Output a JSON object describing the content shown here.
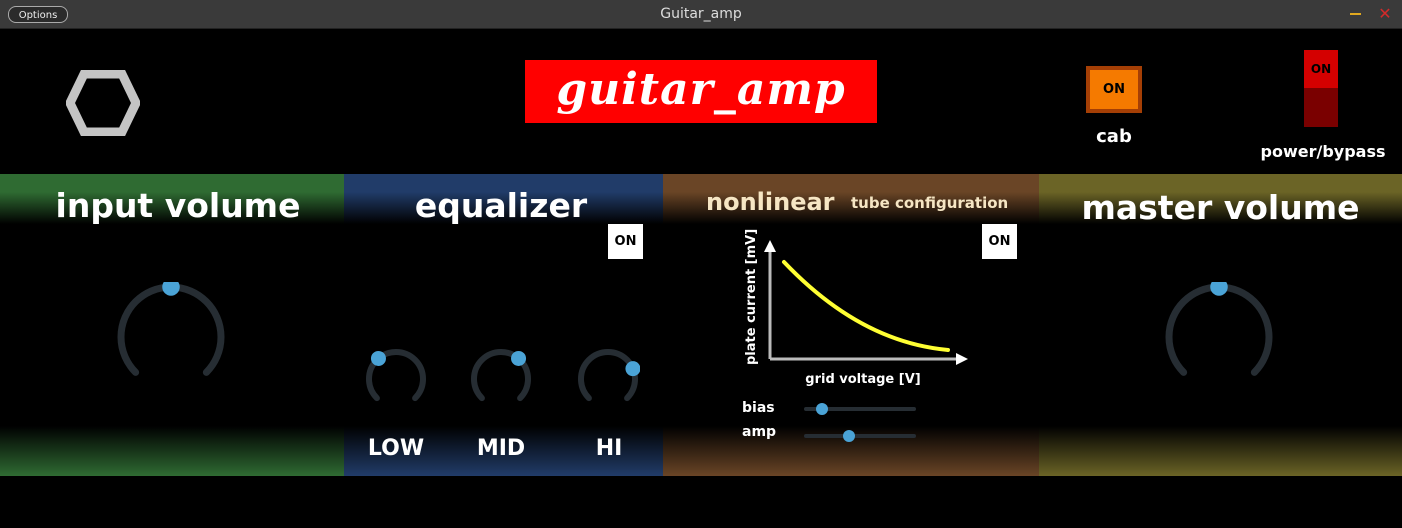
{
  "window": {
    "title": "Guitar_amp",
    "options_label": "Options"
  },
  "header": {
    "logo_text": "guitar_amp",
    "cab_label": "cab",
    "cab_state": "ON",
    "power_label": "power/bypass",
    "power_state": "ON"
  },
  "input_volume": {
    "title": "input volume",
    "knob_value": 0.5
  },
  "equalizer": {
    "title": "equalizer",
    "toggle": "ON",
    "bands": [
      {
        "label": "LOW",
        "value": 0.35
      },
      {
        "label": "MID",
        "value": 0.65
      },
      {
        "label": "HI",
        "value": 0.75
      }
    ]
  },
  "nonlinear": {
    "title": "nonlinear",
    "subtitle": "tube configuration",
    "toggle": "ON",
    "plot": {
      "xlabel": "grid voltage [V]",
      "ylabel": "plate current [mV]",
      "curve_color": "#ffff33"
    },
    "sliders": [
      {
        "label": "bias",
        "value": 0.16
      },
      {
        "label": "amp",
        "value": 0.4
      }
    ]
  },
  "master_volume": {
    "title": "master volume",
    "knob_value": 0.5
  },
  "colors": {
    "accent": "#4aa3d6",
    "knob_track": "#262d33",
    "input_panel": "#2f6b32",
    "eq_panel": "#213c69",
    "nonlinear_panel": "#6a4526",
    "master_panel": "#6b6426",
    "logo_bg": "#ff0000",
    "cab_on": "#f57a00",
    "power_on": "#d40000"
  }
}
